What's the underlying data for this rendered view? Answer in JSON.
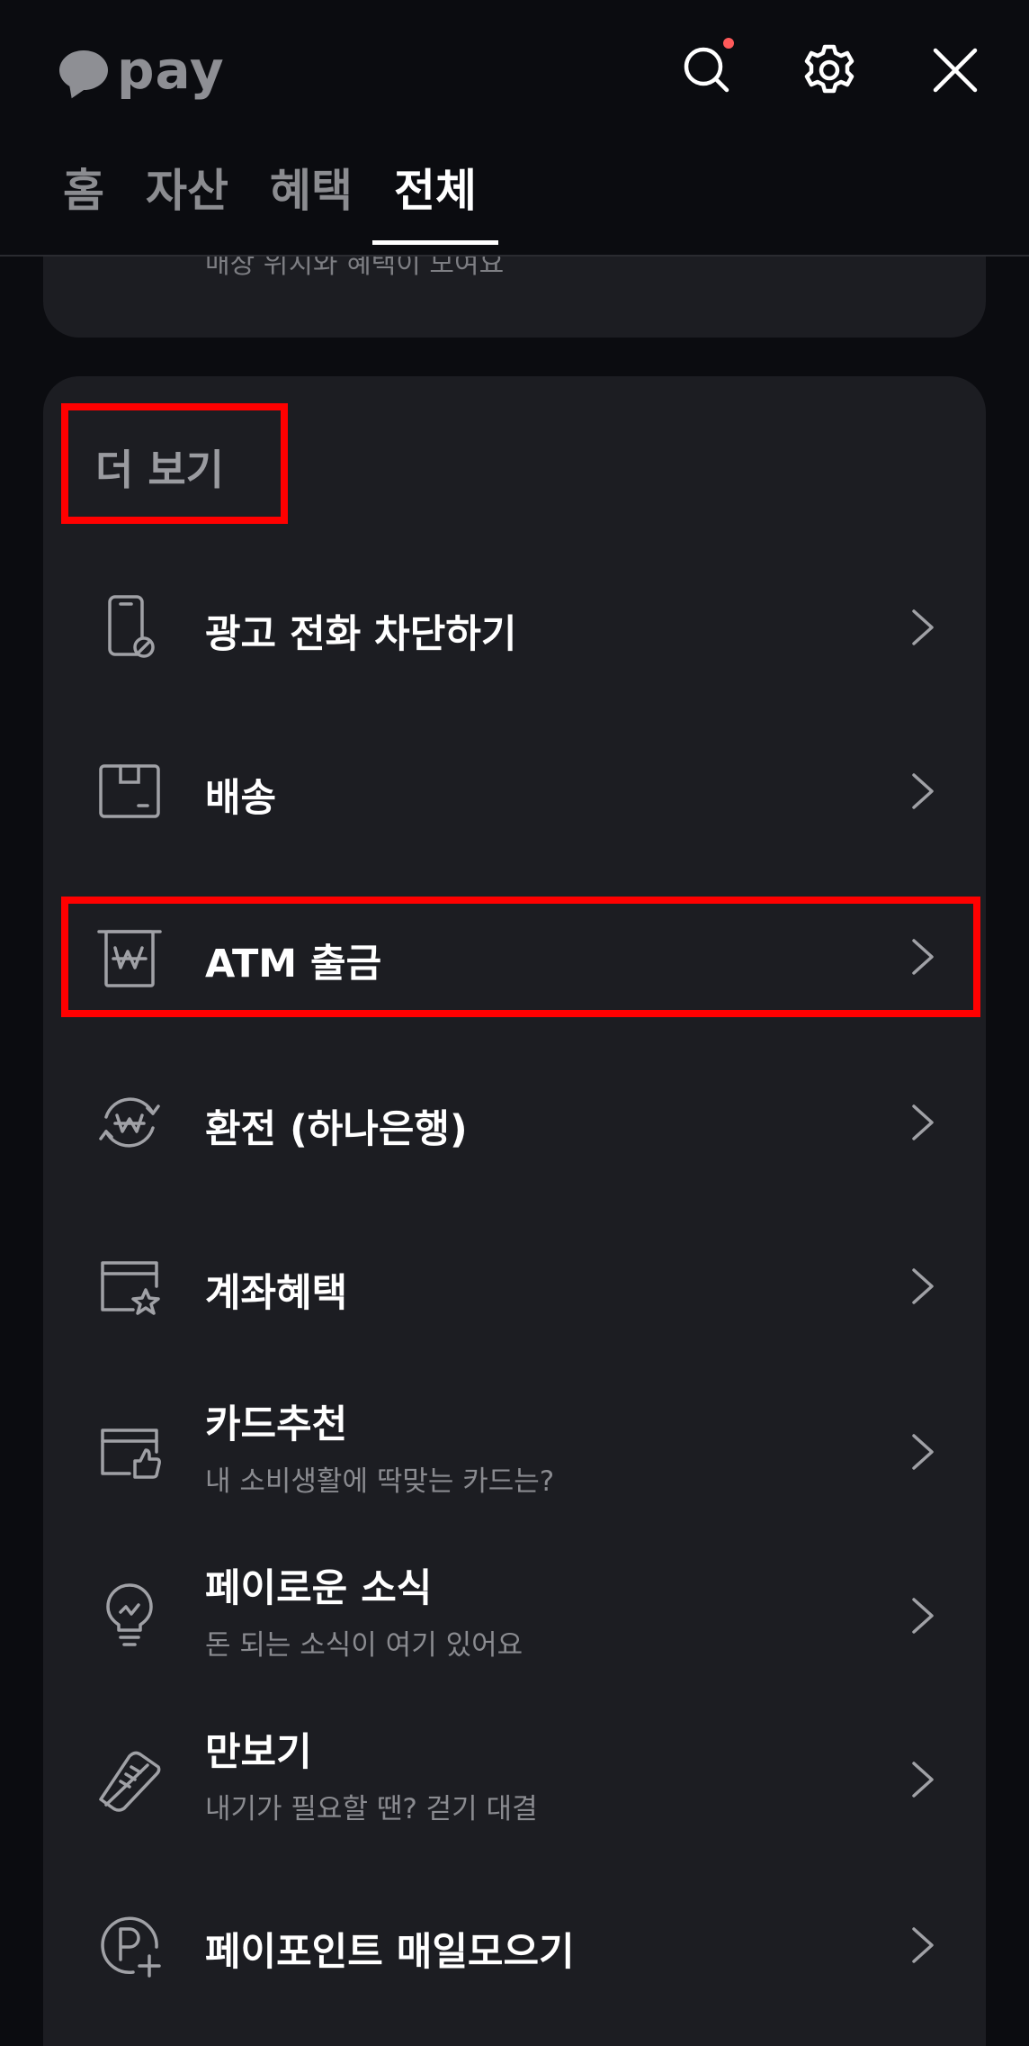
{
  "header": {
    "logo_text": "pay",
    "icons": [
      "search-icon",
      "gear-icon",
      "close-icon"
    ],
    "notification_dot_color": "#ff5a5a"
  },
  "tabs": [
    {
      "label": "홈",
      "active": false
    },
    {
      "label": "자산",
      "active": false
    },
    {
      "label": "혜택",
      "active": false
    },
    {
      "label": "전체",
      "active": true
    }
  ],
  "prev_card": {
    "subtitle": "매장 위치와 혜택이 모여요"
  },
  "section": {
    "title": "더 보기",
    "items": [
      {
        "icon": "phone-block-icon",
        "label": "광고 전화 차단하기",
        "desc": ""
      },
      {
        "icon": "box-icon",
        "label": "배송",
        "desc": ""
      },
      {
        "icon": "atm-won-icon",
        "label": "ATM 출금",
        "desc": ""
      },
      {
        "icon": "exchange-won-icon",
        "label": "환전 (하나은행)",
        "desc": ""
      },
      {
        "icon": "account-star-icon",
        "label": "계좌혜택",
        "desc": ""
      },
      {
        "icon": "card-thumb-icon",
        "label": "카드추천",
        "desc": "내 소비생활에 딱맞는 카드는?"
      },
      {
        "icon": "lightbulb-icon",
        "label": "페이로운 소식",
        "desc": "돈 되는 소식이 여기 있어요"
      },
      {
        "icon": "sneaker-icon",
        "label": "만보기",
        "desc": "내기가 필요할 땐? 걷기 대결"
      },
      {
        "icon": "point-plus-icon",
        "label": "페이포인트 매일모으기",
        "desc": ""
      }
    ]
  },
  "highlight_color": "#ff0000"
}
